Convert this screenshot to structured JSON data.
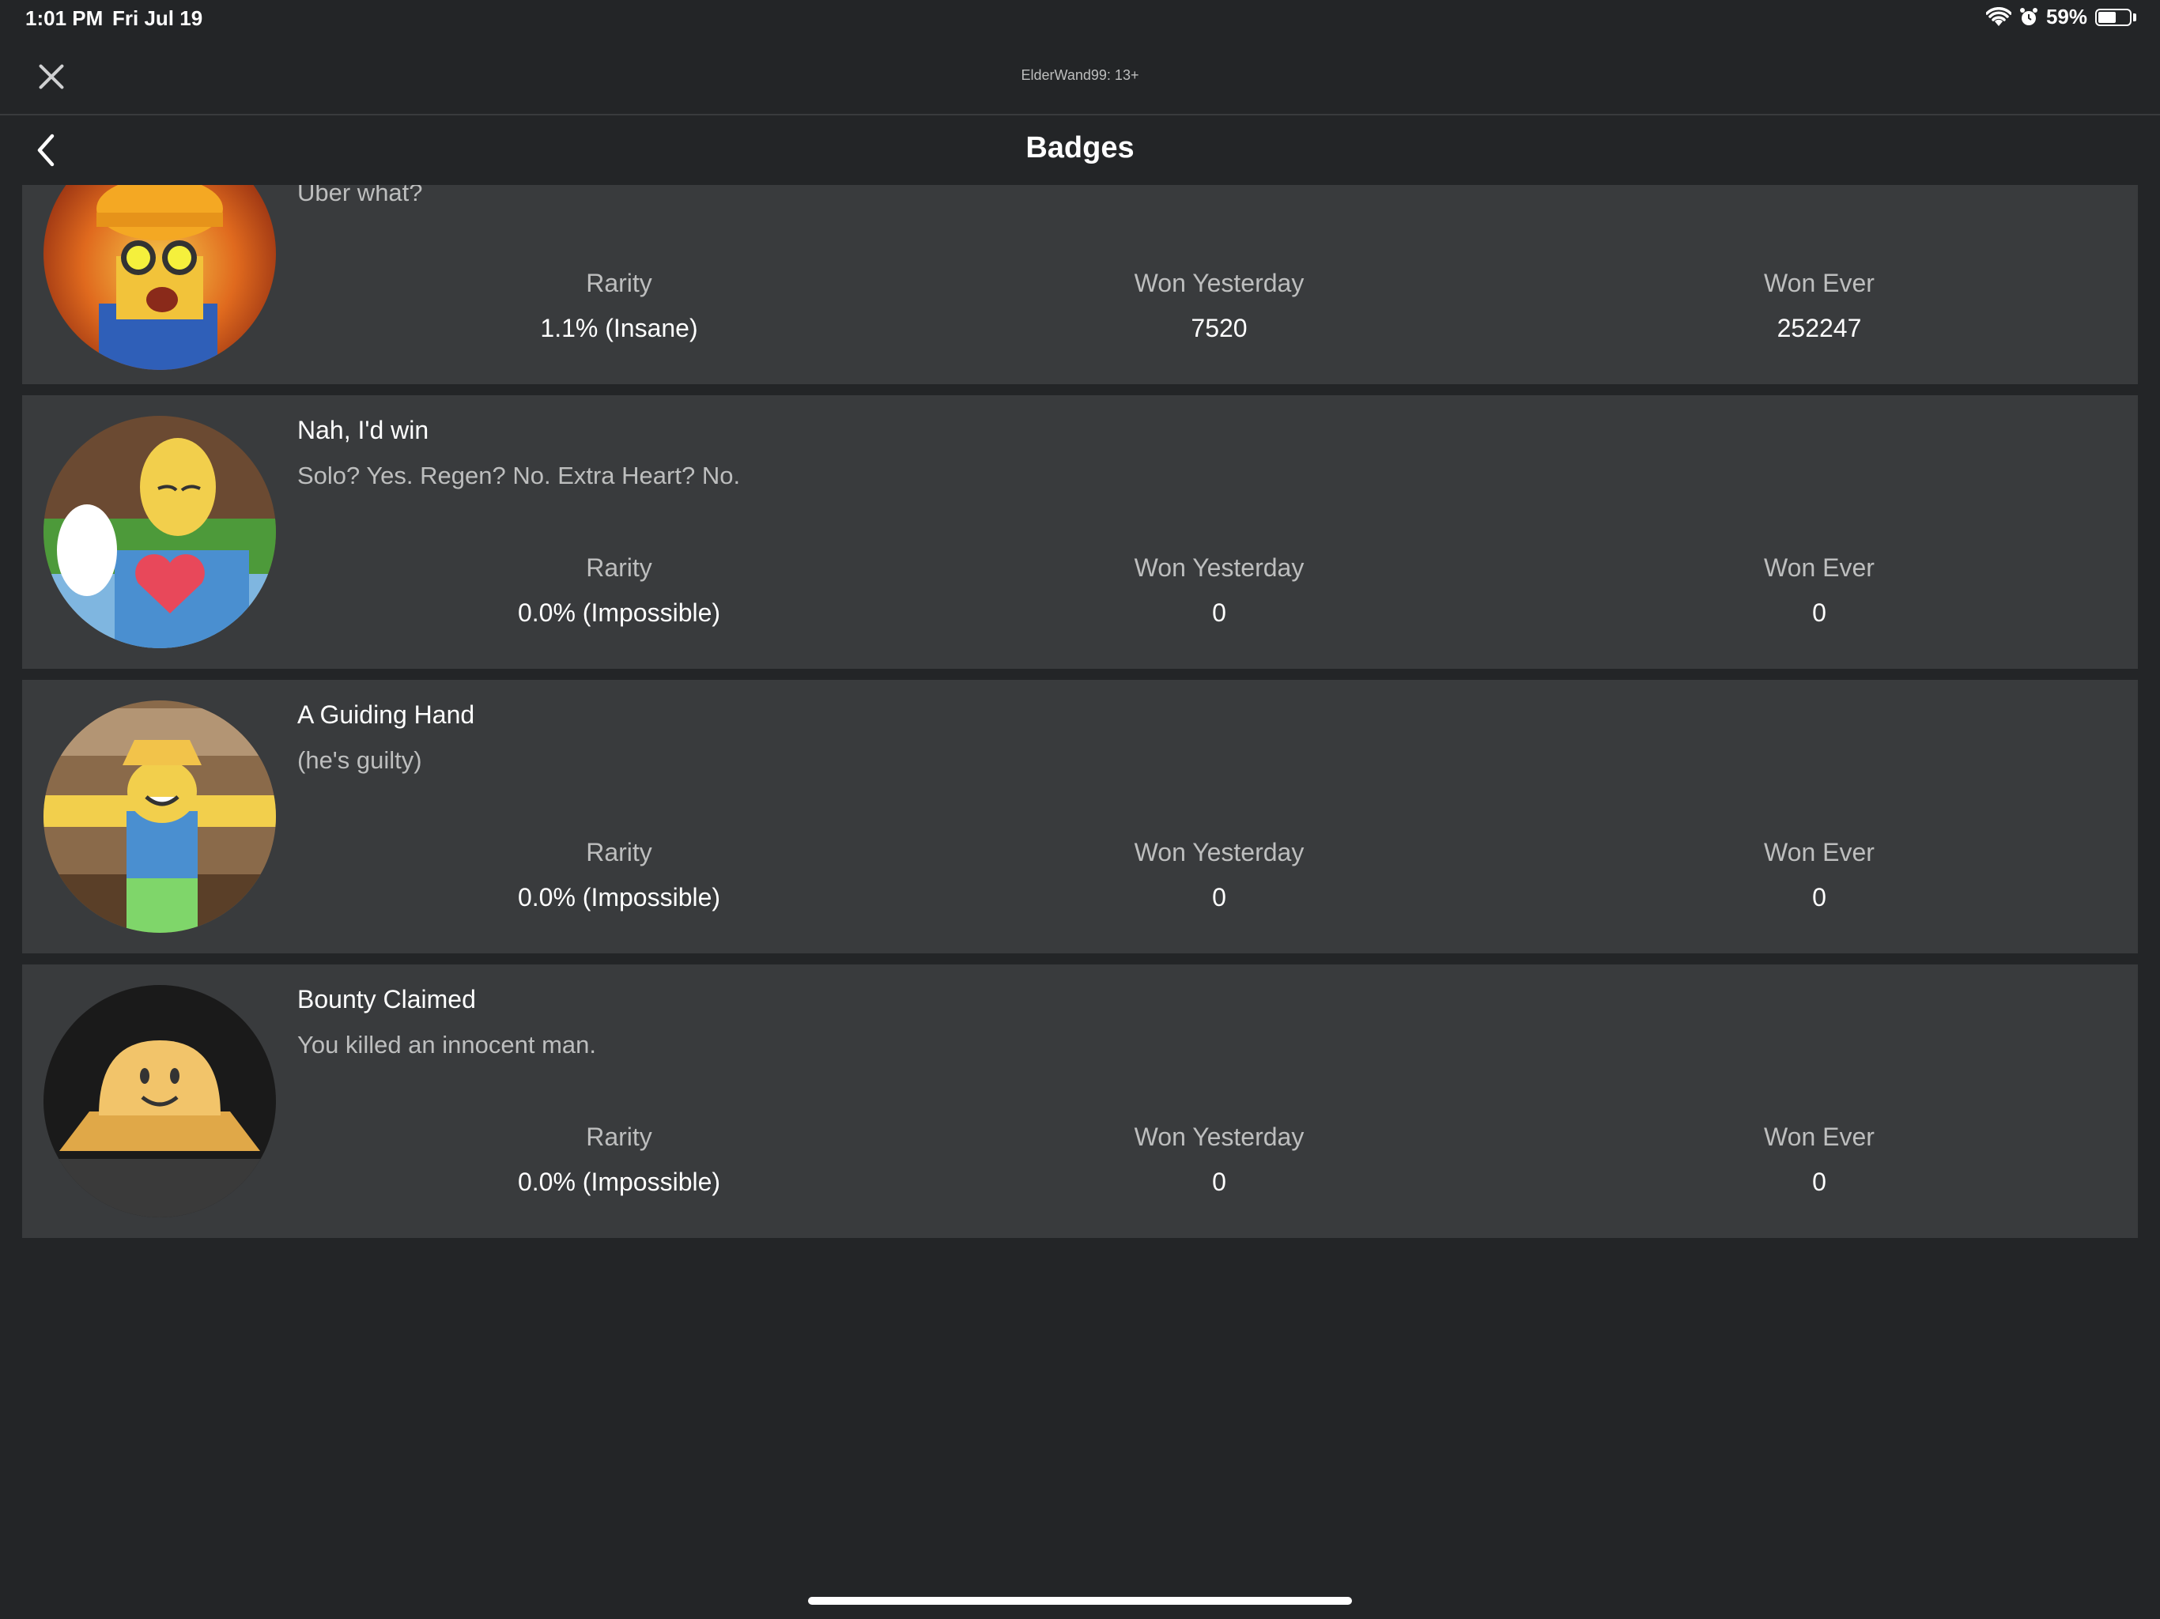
{
  "status_bar": {
    "time": "1:01 PM",
    "date": "Fri Jul 19",
    "battery": "59%",
    "battery_level": 0.59
  },
  "header": {
    "account": "ElderWand99: 13+",
    "title": "Badges"
  },
  "badges": [
    {
      "name": "",
      "description": "Uber what?",
      "rarity_label": "Rarity",
      "rarity": "1.1% (Insane)",
      "won_yesterday_label": "Won Yesterday",
      "won_yesterday": "7520",
      "won_ever_label": "Won Ever",
      "won_ever": "252247"
    },
    {
      "name": "Nah, I'd win",
      "description": "Solo? Yes. Regen? No. Extra Heart? No.",
      "rarity_label": "Rarity",
      "rarity": "0.0% (Impossible)",
      "won_yesterday_label": "Won Yesterday",
      "won_yesterday": "0",
      "won_ever_label": "Won Ever",
      "won_ever": "0"
    },
    {
      "name": "A Guiding Hand",
      "description": "(he's guilty)",
      "rarity_label": "Rarity",
      "rarity": "0.0% (Impossible)",
      "won_yesterday_label": "Won Yesterday",
      "won_yesterday": "0",
      "won_ever_label": "Won Ever",
      "won_ever": "0"
    },
    {
      "name": "Bounty Claimed",
      "description": "You killed an innocent man.",
      "rarity_label": "Rarity",
      "rarity": "0.0% (Impossible)",
      "won_yesterday_label": "Won Yesterday",
      "won_yesterday": "0",
      "won_ever_label": "Won Ever",
      "won_ever": "0"
    }
  ]
}
